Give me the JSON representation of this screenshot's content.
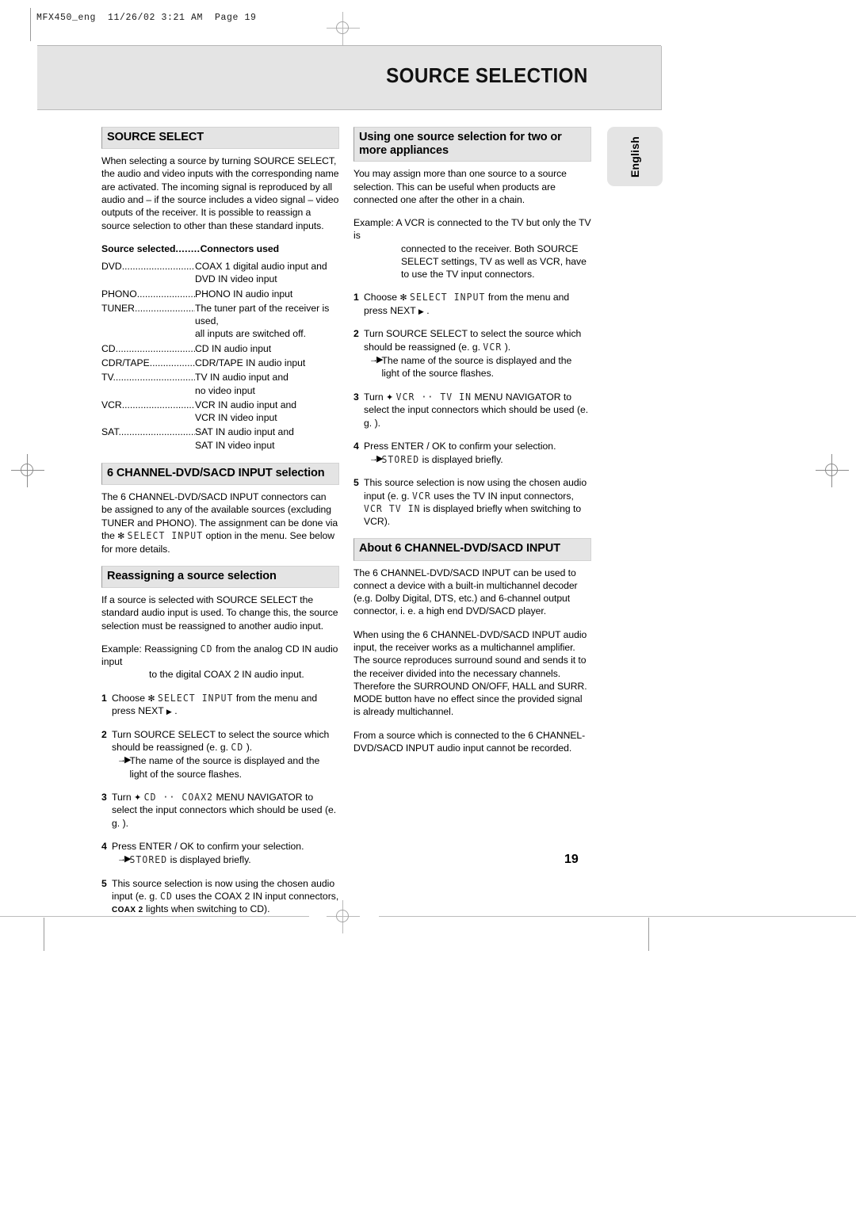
{
  "print_header": "MFX450_eng  11/26/02 3:21 AM  Page 19",
  "masthead": {
    "title": "SOURCE SELECTION"
  },
  "language_tab": {
    "label": "English"
  },
  "page_number": "19",
  "left_column": {
    "source_select": {
      "heading": "SOURCE SELECT",
      "intro": "When selecting a source by turning SOURCE SELECT, the audio and video inputs with the corresponding name are activated. The incoming signal is reproduced by all audio and – if the source includes a video signal – video outputs of the receiver. It is possible to reassign a source selection to other than these standard inputs.",
      "table": {
        "head_left": "Source selected",
        "head_dots": "........",
        "head_right": "Connectors used",
        "rows": [
          {
            "source": "DVD",
            "dots": "..............................",
            "lines": [
              "COAX 1 digital audio input and",
              "DVD IN video input"
            ]
          },
          {
            "source": "PHONO",
            "dots": "........................",
            "lines": [
              "PHONO IN audio input"
            ]
          },
          {
            "source": "TUNER",
            "dots": "........................",
            "lines": [
              "The tuner part of the receiver is used,",
              "all inputs are switched off."
            ]
          },
          {
            "source": "CD",
            "dots": "................................",
            "lines": [
              "CD IN audio input"
            ]
          },
          {
            "source": "CDR/TAPE",
            "dots": "....................",
            "lines": [
              "CDR/TAPE IN audio input"
            ]
          },
          {
            "source": "TV",
            "dots": "................................",
            "lines": [
              "TV IN audio input and",
              "no video input"
            ]
          },
          {
            "source": "VCR",
            "dots": "..............................",
            "lines": [
              "VCR IN audio input and",
              "VCR IN video input"
            ]
          },
          {
            "source": "SAT",
            "dots": "..............................",
            "lines": [
              "SAT IN audio input and",
              "SAT IN video input"
            ]
          }
        ]
      }
    },
    "six_channel": {
      "heading": "6 CHANNEL-DVD/SACD INPUT selection",
      "text_a": "The 6 CHANNEL-DVD/SACD INPUT connectors can be assigned to any of the available sources (excluding TUNER and PHONO). The assignment can be done via the",
      "menu_star": "✻",
      "menu_item": "SELECT INPUT",
      "text_b": "option in the menu. See below for more details."
    },
    "reassigning": {
      "heading": "Reassigning a source selection",
      "text": "If a source is selected with SOURCE SELECT the standard audio input is used. To change this, the source selection must be reassigned to another audio input.",
      "example_lead": "Example: Reassigning",
      "example_lcd": "CD",
      "example_mid": "from the analog CD IN audio input",
      "example_cont": "to the digital COAX 2 IN audio input.",
      "steps": [
        {
          "n": "1",
          "text_a": "Choose",
          "star": "✻",
          "lcd": "SELECT INPUT",
          "text_b": "from the menu and press NEXT",
          "triangle": "▶",
          "text_c": "."
        },
        {
          "n": "2",
          "text_a": "Turn SOURCE SELECT to select the source which should be reassigned (e. g.",
          "lcd": "CD",
          "text_b": ").",
          "sub_arrow": "→▶",
          "sub": "The name of the source is displayed and the light of the source flashes."
        },
        {
          "n": "3",
          "text_a": "Turn",
          "updown": "✦",
          "text_b": "MENU NAVIGATOR to select the input connectors which should be used (e. g.",
          "lcd": "CD  ··  COAX2",
          "text_c": ")."
        },
        {
          "n": "4",
          "text_a": "Press ENTER / OK to confirm your selection.",
          "sub_arrow": "→▶",
          "sub_lcd": "STORED",
          "sub_b": "is displayed briefly."
        },
        {
          "n": "5",
          "text_a": "This source selection is now using the chosen audio input (e. g.",
          "lcd": "CD",
          "text_b": "uses the COAX 2 IN input connectors,",
          "badge": "COAX 2",
          "text_c": "lights when switching to CD)."
        }
      ]
    }
  },
  "right_column": {
    "one_source": {
      "heading": "Using one source selection for two or more appliances",
      "intro": "You may assign more than one source to a source selection. This can be useful when products are connected one after the other in a chain.",
      "example_lead": "Example: A VCR is connected to the TV but only the TV is",
      "example_cont": "connected to the receiver. Both SOURCE SELECT settings, TV as well as VCR, have to use the TV input connectors.",
      "steps": [
        {
          "n": "1",
          "text_a": "Choose",
          "star": "✻",
          "lcd": "SELECT INPUT",
          "text_b": "from the menu and press NEXT",
          "triangle": "▶",
          "text_c": "."
        },
        {
          "n": "2",
          "text_a": "Turn SOURCE SELECT to select the source which should be reassigned (e. g.",
          "lcd": "VCR",
          "text_b": ").",
          "sub_arrow": "→▶",
          "sub": "The name of the source is displayed and the light of the source flashes."
        },
        {
          "n": "3",
          "text_a": "Turn",
          "updown": "✦",
          "text_b": "MENU NAVIGATOR to select the input connectors which should be used (e. g.",
          "lcd": "VCR  ··  TV IN",
          "text_c": ")."
        },
        {
          "n": "4",
          "text_a": "Press ENTER / OK to confirm your selection.",
          "sub_arrow": "→▶",
          "sub_lcd": "STORED",
          "sub_b": "is displayed briefly."
        },
        {
          "n": "5",
          "text_a": "This source selection is now using the chosen audio input (e. g.",
          "lcd": "VCR",
          "text_b": "uses the TV IN input connectors,",
          "lcd2": "VCR  TV IN",
          "text_c": "is displayed briefly when switching to VCR)."
        }
      ]
    },
    "about_six": {
      "heading": "About 6 CHANNEL-DVD/SACD INPUT",
      "para1": "The 6 CHANNEL-DVD/SACD INPUT can be used to connect a device with a built-in multichannel decoder (e.g. Dolby Digital, DTS, etc.) and 6-channel output connector, i. e. a high end DVD/SACD player.",
      "para2": "When using the 6 CHANNEL-DVD/SACD INPUT audio input, the receiver works as a multichannel amplifier. The source reproduces surround sound and sends it to the receiver divided into the necessary channels. Therefore the SURROUND ON/OFF, HALL and SURR. MODE button have no effect since the provided signal is already multichannel.",
      "para3": "From a source which is connected to the 6 CHANNEL-DVD/SACD INPUT audio input cannot be recorded."
    }
  }
}
